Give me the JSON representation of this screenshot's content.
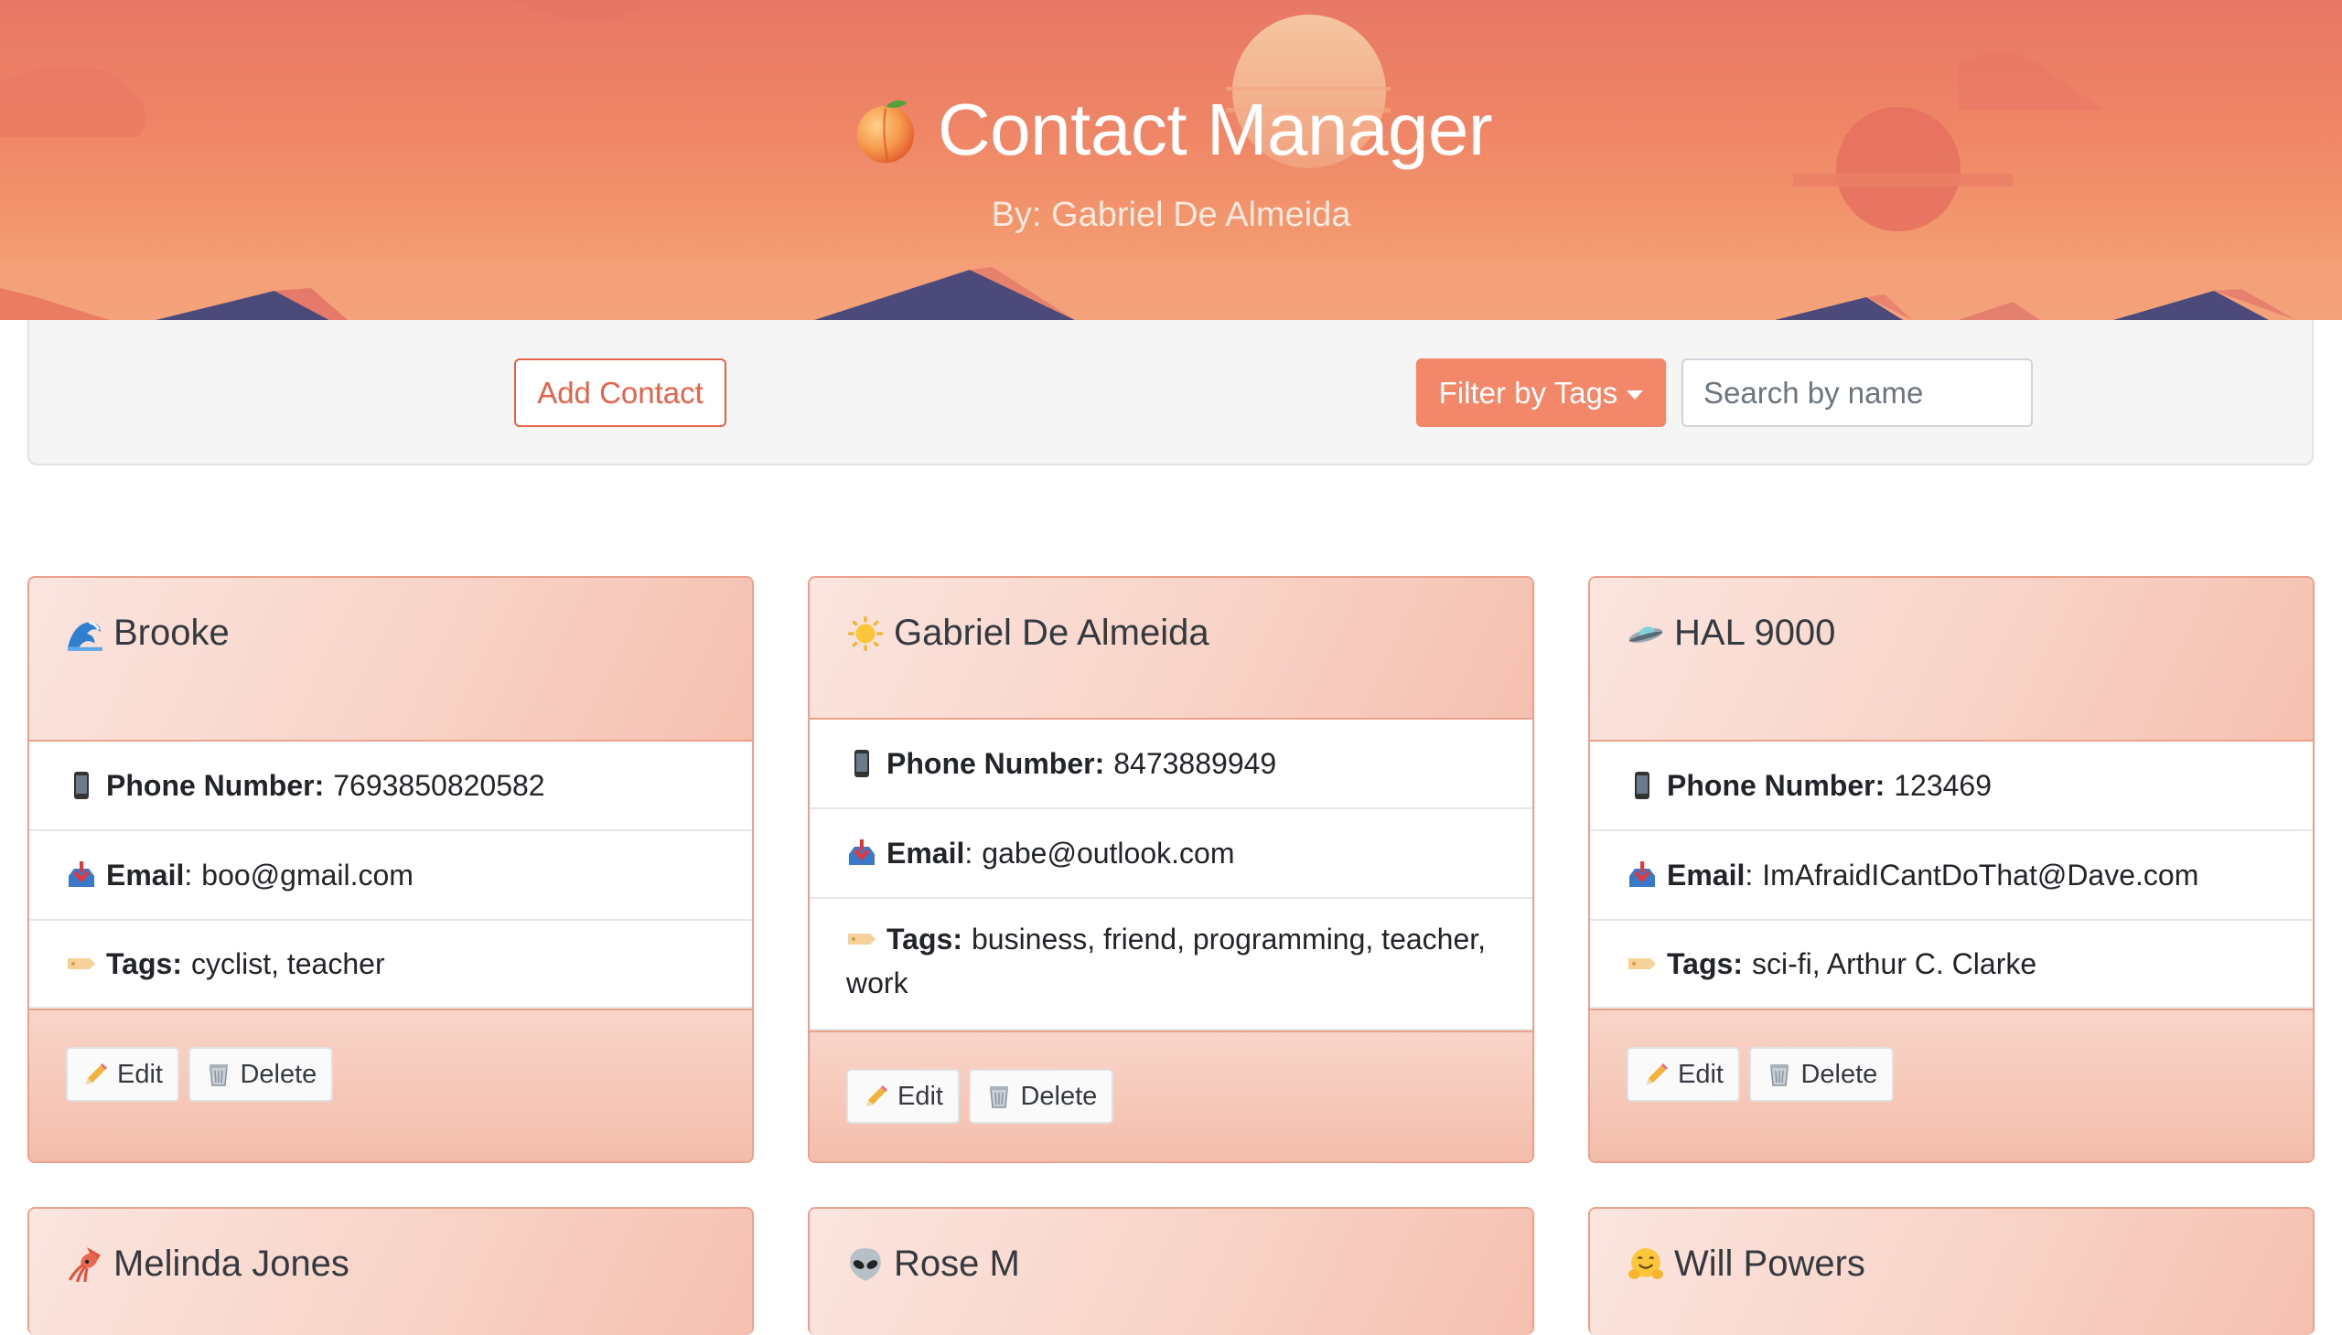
{
  "header": {
    "title": "Contact Manager",
    "subtitle": "By: Gabriel De Almeida",
    "logo_icon": "peach-icon"
  },
  "toolbar": {
    "add_label": "Add Contact",
    "filter_label": "Filter by Tags",
    "search_placeholder": "Search by name"
  },
  "labels": {
    "phone": "Phone Number:",
    "email": "Email",
    "tags": "Tags:",
    "edit": "Edit",
    "delete": "Delete"
  },
  "contacts": [
    {
      "icon": "wave-icon",
      "name": "Brooke",
      "phone": "7693850820582",
      "email": "boo@gmail.com",
      "tags": "cyclist, teacher"
    },
    {
      "icon": "sun-icon",
      "name": "Gabriel De Almeida",
      "phone": "8473889949",
      "email": "gabe@outlook.com",
      "tags_line1": "business, friend, programming, teacher,",
      "tags_line2": "work"
    },
    {
      "icon": "flying-saucer-icon",
      "name": "HAL 9000",
      "phone": "123469",
      "email": "ImAfraidICantDoThat@Dave.com",
      "tags": "sci-fi, Arthur C. Clarke"
    },
    {
      "icon": "squid-icon",
      "name": "Melinda Jones"
    },
    {
      "icon": "alien-icon",
      "name": "Rose M"
    },
    {
      "icon": "hugging-face-icon",
      "name": "Will Powers"
    }
  ],
  "colors": {
    "accent": "#e3644a",
    "filter_button": "#f2876a",
    "card_border": "#eba28d"
  }
}
